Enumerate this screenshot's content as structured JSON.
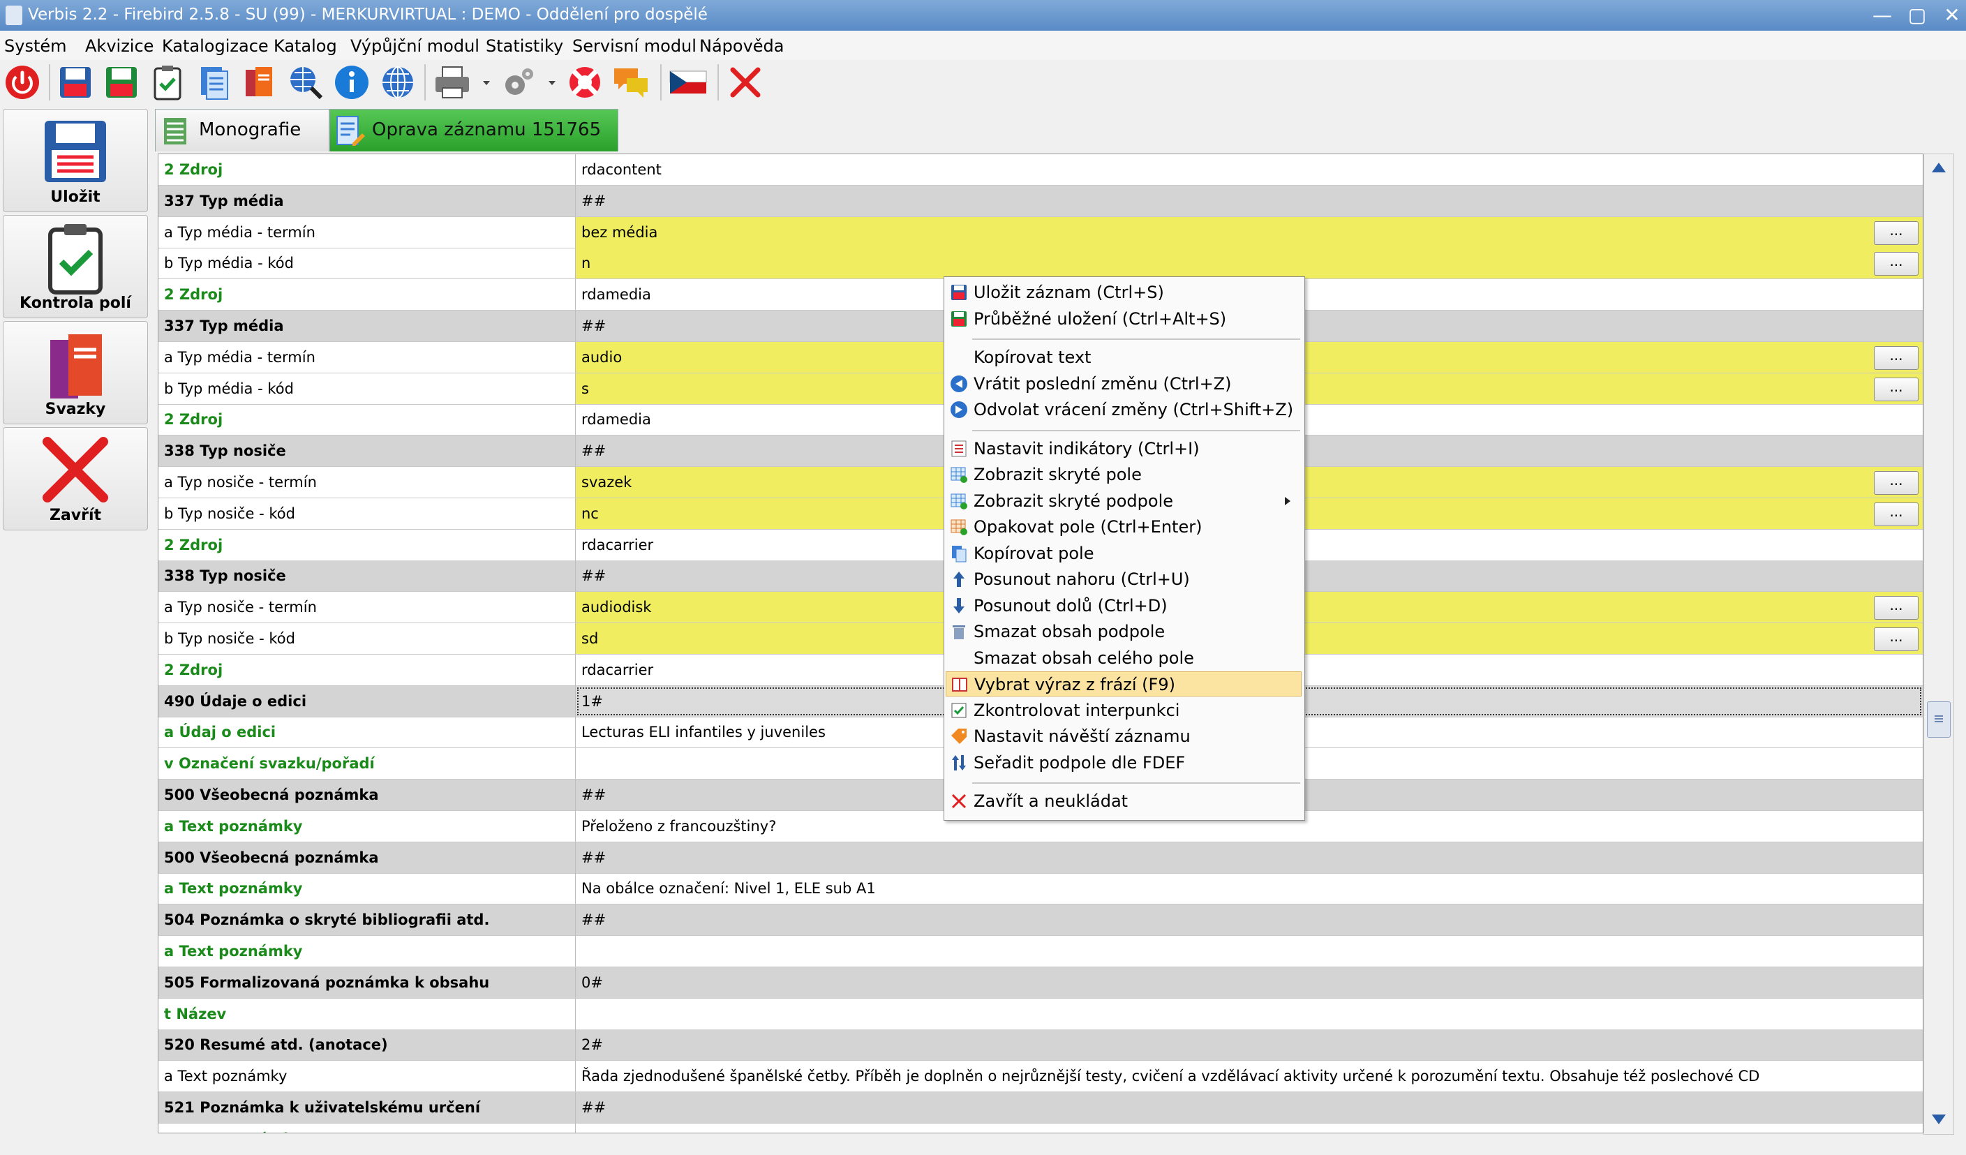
{
  "window": {
    "title": "Verbis 2.2 - Firebird 2.5.8 - SU (99) - MERKURVIRTUAL : DEMO - Oddělení pro dospělé"
  },
  "menu": [
    "Systém",
    "Akvizice",
    "Katalogizace",
    "Katalog",
    "Výpůjční modul",
    "Statistiky",
    "Servisní modul",
    "Nápověda"
  ],
  "toolbar": {
    "icons": [
      "power-icon",
      "save-icon",
      "save-green-icon",
      "clipboard-check-icon",
      "document-icon",
      "books-icon",
      "globe-search-icon",
      "info-icon",
      "globe-icon",
      "printer-icon",
      "gear-icon",
      "lifebuoy-icon",
      "chat-icon",
      "czech-flag-icon",
      "close-icon"
    ]
  },
  "left_panel": {
    "buttons": [
      {
        "label": "Uložit",
        "icon": "save-icon"
      },
      {
        "label": "Kontrola polí",
        "icon": "clipboard-check-icon"
      },
      {
        "label": "Svazky",
        "icon": "books-icon"
      },
      {
        "label": "Zavřít",
        "icon": "close-icon"
      }
    ]
  },
  "tabs": [
    {
      "label": "Monografie",
      "active": false
    },
    {
      "label": "Oprava záznamu 151765",
      "active": true
    }
  ],
  "grid": {
    "rows": [
      {
        "field": "2 Zdroj",
        "value": "rdacontent",
        "style": "green"
      },
      {
        "field": "337 Typ média",
        "value": "##",
        "style": "gray"
      },
      {
        "field": "a Typ média - termín",
        "value": "bez média",
        "style": "yellow"
      },
      {
        "field": "b Typ média - kód",
        "value": "n",
        "style": "yellow"
      },
      {
        "field": "2 Zdroj",
        "value": "rdamedia",
        "style": "green"
      },
      {
        "field": "337 Typ média",
        "value": "##",
        "style": "gray"
      },
      {
        "field": "a Typ média - termín",
        "value": "audio",
        "style": "yellow"
      },
      {
        "field": "b Typ média - kód",
        "value": "s",
        "style": "yellow"
      },
      {
        "field": "2 Zdroj",
        "value": "rdamedia",
        "style": "green"
      },
      {
        "field": "338 Typ nosiče",
        "value": "##",
        "style": "gray"
      },
      {
        "field": "a Typ nosiče - termín",
        "value": "svazek",
        "style": "yellow"
      },
      {
        "field": "b Typ nosiče - kód",
        "value": "nc",
        "style": "yellow"
      },
      {
        "field": "2 Zdroj",
        "value": "rdacarrier",
        "style": "green"
      },
      {
        "field": "338 Typ nosiče",
        "value": "##",
        "style": "gray"
      },
      {
        "field": "a Typ nosiče - termín",
        "value": "audiodisk",
        "style": "yellow"
      },
      {
        "field": "b Typ nosiče - kód",
        "value": "sd",
        "style": "yellow"
      },
      {
        "field": "2 Zdroj",
        "value": "rdacarrier",
        "style": "green"
      },
      {
        "field": "490 Údaje o edici",
        "value": "1#",
        "style": "sel"
      },
      {
        "field": "a Údaj o edici",
        "value": "Lecturas ELI infantiles y juveniles",
        "style": "green"
      },
      {
        "field": "v Označení svazku/pořadí",
        "value": "",
        "style": "green"
      },
      {
        "field": "500 Všeobecná poznámka",
        "value": "##",
        "style": "gray"
      },
      {
        "field": "a Text poznámky",
        "value": "Přeloženo z francouzštiny?",
        "style": "green"
      },
      {
        "field": "500 Všeobecná poznámka",
        "value": "##",
        "style": "gray"
      },
      {
        "field": "a Text poznámky",
        "value": "Na obálce označení: Nivel 1, ELE sub A1",
        "style": "green"
      },
      {
        "field": "504 Poznámka o skryté bibliografii atd.",
        "value": "##",
        "style": "gray"
      },
      {
        "field": "a Text poznámky",
        "value": "",
        "style": "green"
      },
      {
        "field": "505 Formalizovaná poznámka k obsahu",
        "value": "0#",
        "style": "gray"
      },
      {
        "field": "t Název",
        "value": "",
        "style": "green"
      },
      {
        "field": "520 Resumé atd. (anotace)",
        "value": "2#",
        "style": "gray"
      },
      {
        "field": "a Text poznámky",
        "value": "Řada zjednodušené španělské četby. Příběh je doplněn o nejrůznější testy, cvičení a vzdělávací aktivity určené k porozumění textu. Obsahuje též poslechové CD",
        "style": "plain"
      },
      {
        "field": "521 Poznámka k uživatelskému určení",
        "value": "##",
        "style": "gray"
      },
      {
        "field": "a Text poznámky",
        "value": "",
        "style": "green"
      }
    ],
    "ellipsis_label": "..."
  },
  "context_menu": {
    "items": [
      {
        "label": "Uložit záznam (Ctrl+S)",
        "icon": "save-icon"
      },
      {
        "label": "Průběžné uložení (Ctrl+Alt+S)",
        "icon": "save-green-icon"
      },
      {
        "sep": true
      },
      {
        "label": "Kopírovat text",
        "icon": ""
      },
      {
        "label": "Vrátit poslední změnu (Ctrl+Z)",
        "icon": "undo-icon"
      },
      {
        "label": "Odvolat vrácení změny (Ctrl+Shift+Z)",
        "icon": "redo-icon"
      },
      {
        "sep": true
      },
      {
        "label": "Nastavit indikátory (Ctrl+I)",
        "icon": "indicator-icon"
      },
      {
        "label": "Zobrazit skryté pole",
        "icon": "grid-icon"
      },
      {
        "label": "Zobrazit skryté podpole",
        "icon": "grid-icon",
        "submenu": true
      },
      {
        "label": "Opakovat pole (Ctrl+Enter)",
        "icon": "repeat-icon"
      },
      {
        "label": "Kopírovat pole",
        "icon": "copy-icon"
      },
      {
        "label": "Posunout nahoru (Ctrl+U)",
        "icon": "arrow-up-icon"
      },
      {
        "label": "Posunout dolů (Ctrl+D)",
        "icon": "arrow-down-icon"
      },
      {
        "label": "Smazat obsah podpole",
        "icon": "trash-icon"
      },
      {
        "label": "Smazat obsah celého pole",
        "icon": ""
      },
      {
        "label": "Vybrat výraz z frází (F9)",
        "icon": "book-icon",
        "highlighted": true
      },
      {
        "label": "Zkontrolovat interpunkci",
        "icon": "check-icon"
      },
      {
        "label": "Nastavit návěští záznamu",
        "icon": "tag-icon"
      },
      {
        "label": "Seřadit podpole dle FDEF",
        "icon": "sort-icon"
      },
      {
        "sep": true
      },
      {
        "label": "Zavřít a neukládat",
        "icon": "close-icon"
      }
    ]
  },
  "colors": {
    "accent_tab": "#2aa12a",
    "field_green": "#1a8a1a",
    "row_gray": "#d4d4d4",
    "row_yellow": "#f0ee60",
    "menu_highlight": "#fbe3a2"
  }
}
